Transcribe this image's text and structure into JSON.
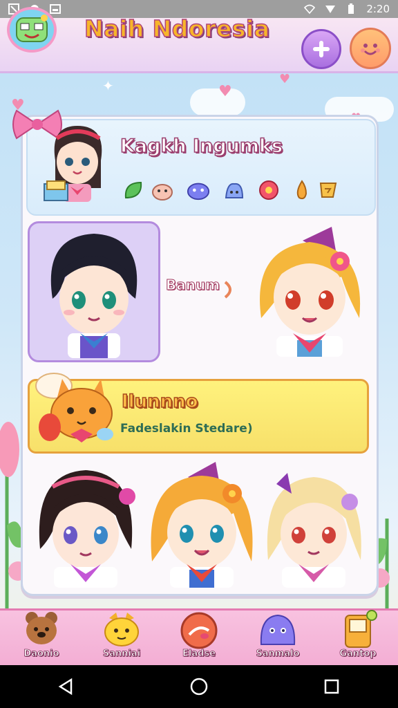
{
  "status_bar": {
    "time": "2:20"
  },
  "header": {
    "title": "Naih Ndoresia"
  },
  "profile": {
    "name": "Kagkh Ingumks"
  },
  "selected_character": {
    "label": "Banum"
  },
  "banner": {
    "title": "Ilunnno",
    "subtitle": "Fadeslakin Stedare)"
  },
  "bottom_nav": {
    "items": [
      {
        "label": "Daonio",
        "icon": "bear-icon"
      },
      {
        "label": "Sanniai",
        "icon": "cat-face-icon"
      },
      {
        "label": "Eladse",
        "icon": "ball-face-icon"
      },
      {
        "label": "Sanmalo",
        "icon": "slime-icon"
      },
      {
        "label": "Gantop",
        "icon": "gameboy-icon"
      }
    ]
  },
  "colors": {
    "accent": "#f7b52a",
    "header_bg": "#e9d3f3",
    "nav_bg": "#f3aed4",
    "banner_bg": "#fff27d"
  }
}
